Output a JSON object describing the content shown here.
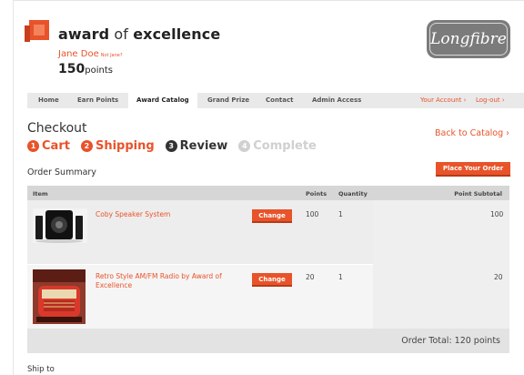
{
  "brand": {
    "name_bold1": "award",
    "name_of": " of ",
    "name_bold2": "excellence",
    "partner_logo": "Longfibre"
  },
  "user": {
    "name": "Jane Doe",
    "not_user": "Not Jane?",
    "points": "150",
    "points_label": "points"
  },
  "nav": {
    "items": [
      "Home",
      "Earn Points",
      "Award Catalog",
      "Grand Prize",
      "Contact",
      "Admin Access"
    ],
    "active": "Award Catalog",
    "your_account": "Your Account ›",
    "log_out": "Log-out ›"
  },
  "checkout": {
    "title": "Checkout",
    "back": "Back to Catalog ›",
    "steps": [
      {
        "num": "1",
        "label": "Cart"
      },
      {
        "num": "2",
        "label": "Shipping"
      },
      {
        "num": "3",
        "label": "Review"
      },
      {
        "num": "4",
        "label": "Complete"
      }
    ],
    "order_summary": "Order Summary",
    "place_order": "Place Your Order"
  },
  "table": {
    "headers": {
      "item": "Item",
      "points": "Points",
      "quantity": "Quantity",
      "subtotal": "Point Subtotal"
    },
    "rows": [
      {
        "name": "Coby Speaker System",
        "change": "Change",
        "points": "100",
        "quantity": "1",
        "subtotal": "100",
        "image": "speaker-system-image"
      },
      {
        "name": "Retro Style AM/FM Radio by Award of Excellence",
        "change": "Change",
        "points": "20",
        "quantity": "1",
        "subtotal": "20",
        "image": "retro-radio-image"
      }
    ],
    "order_total": "Order Total: 120 points"
  },
  "ship_to": "Ship to",
  "colors": {
    "accent": "#e8532a",
    "nav_bg": "#e9e9e9",
    "header_bg": "#d6d6d6"
  }
}
